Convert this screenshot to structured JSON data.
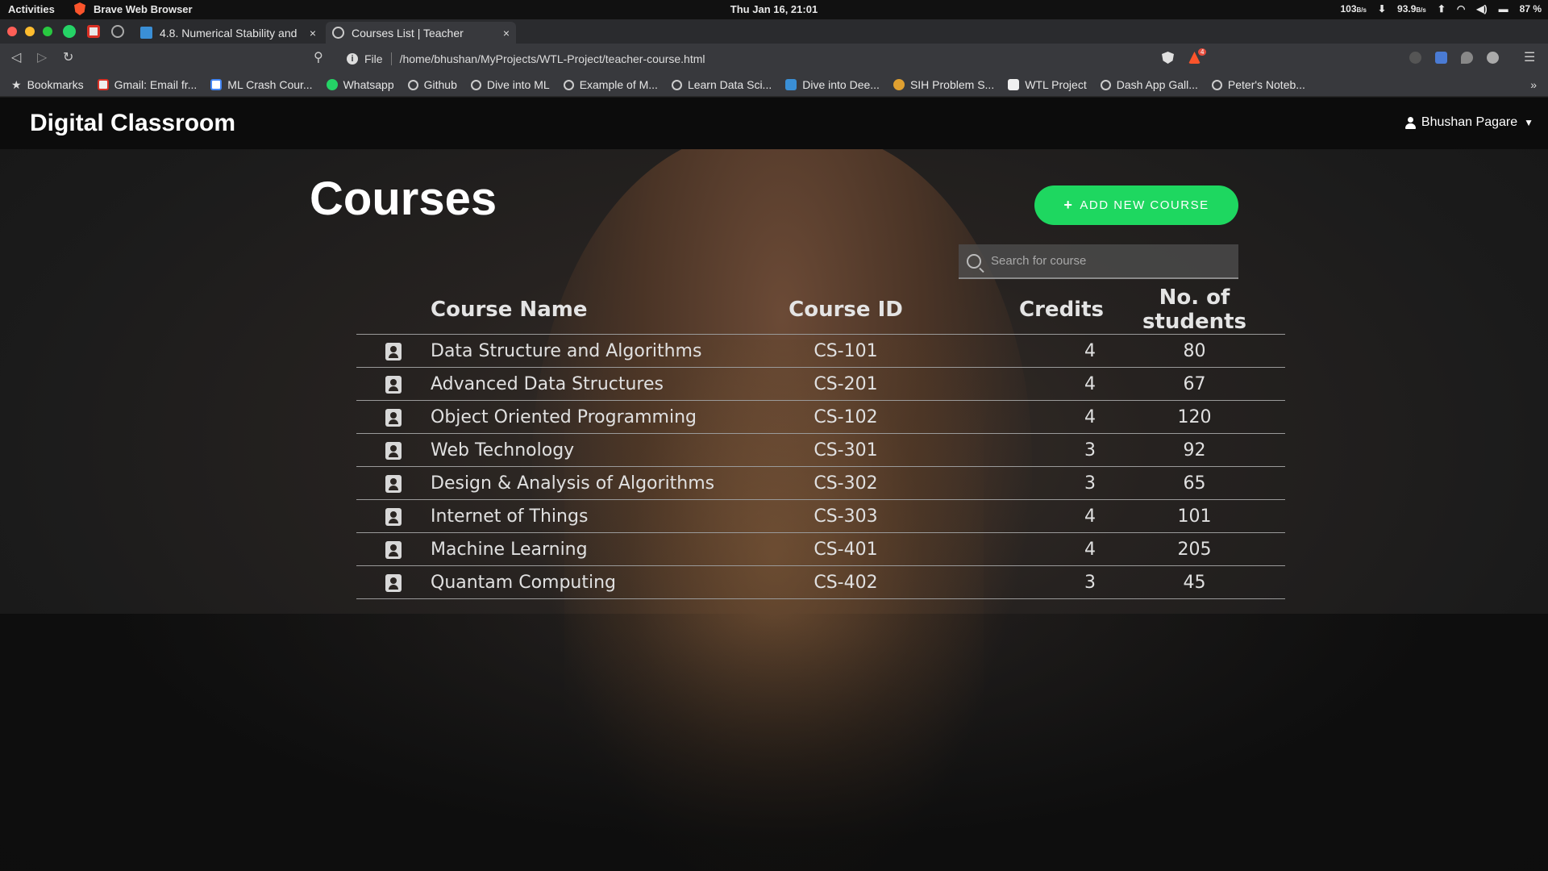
{
  "system_bar": {
    "activities": "Activities",
    "app_name": "Brave Web Browser",
    "clock": "Thu Jan 16, 21:01",
    "down_speed": "103",
    "down_unit": "B/s",
    "up_speed": "93.9",
    "up_unit": "B/s",
    "battery": "87 %"
  },
  "tabs": [
    {
      "title": "4.8. Numerical Stability and",
      "close": "×"
    },
    {
      "title": "Courses List | Teacher",
      "close": "×"
    }
  ],
  "new_tab": "+",
  "address": {
    "scheme_label": "File",
    "url": "/home/bhushan/MyProjects/WTL-Project/teacher-course.html",
    "shield_badge": "4"
  },
  "bookmarks": [
    {
      "label": "Bookmarks",
      "icon": "star-icon"
    },
    {
      "label": "Gmail: Email fr...",
      "icon": "gmail-icon"
    },
    {
      "label": "ML Crash Cour...",
      "icon": "google-icon"
    },
    {
      "label": "Whatsapp",
      "icon": "whatsapp-icon"
    },
    {
      "label": "Github",
      "icon": "github-icon"
    },
    {
      "label": "Dive into ML",
      "icon": "github-icon"
    },
    {
      "label": "Example of M...",
      "icon": "github-icon"
    },
    {
      "label": "Learn Data Sci...",
      "icon": "github-icon"
    },
    {
      "label": "Dive into Dee...",
      "icon": "d2l-icon"
    },
    {
      "label": "SIH Problem S...",
      "icon": "sih-icon"
    },
    {
      "label": "WTL Project",
      "icon": "trello-icon"
    },
    {
      "label": "Dash App Gall...",
      "icon": "globe-icon"
    },
    {
      "label": "Peter's Noteb...",
      "icon": "globe-icon"
    }
  ],
  "bookmarks_more": "»",
  "site": {
    "brand": "Digital Classroom",
    "user_name": "Bhushan Pagare",
    "page_title": "Courses",
    "add_button": "ADD NEW COURSE",
    "search_placeholder": "Search for course",
    "table_headers": {
      "name": "Course Name",
      "id": "Course ID",
      "credits": "Credits",
      "students": "No. of students"
    },
    "courses": [
      {
        "name": "Data Structure and Algorithms",
        "id": "CS-101",
        "credits": "4",
        "students": "80"
      },
      {
        "name": "Advanced Data Structures",
        "id": "CS-201",
        "credits": "4",
        "students": "67"
      },
      {
        "name": "Object Oriented Programming",
        "id": "CS-102",
        "credits": "4",
        "students": "120"
      },
      {
        "name": "Web Technology",
        "id": "CS-301",
        "credits": "3",
        "students": "92"
      },
      {
        "name": "Design & Analysis of Algorithms",
        "id": "CS-302",
        "credits": "3",
        "students": "65"
      },
      {
        "name": "Internet of Things",
        "id": "CS-303",
        "credits": "4",
        "students": "101"
      },
      {
        "name": "Machine Learning",
        "id": "CS-401",
        "credits": "4",
        "students": "205"
      },
      {
        "name": "Quantam Computing",
        "id": "CS-402",
        "credits": "3",
        "students": "45"
      }
    ]
  },
  "colors": {
    "accent_green": "#1ed760",
    "navbar_bg": "#0c0c0c"
  }
}
